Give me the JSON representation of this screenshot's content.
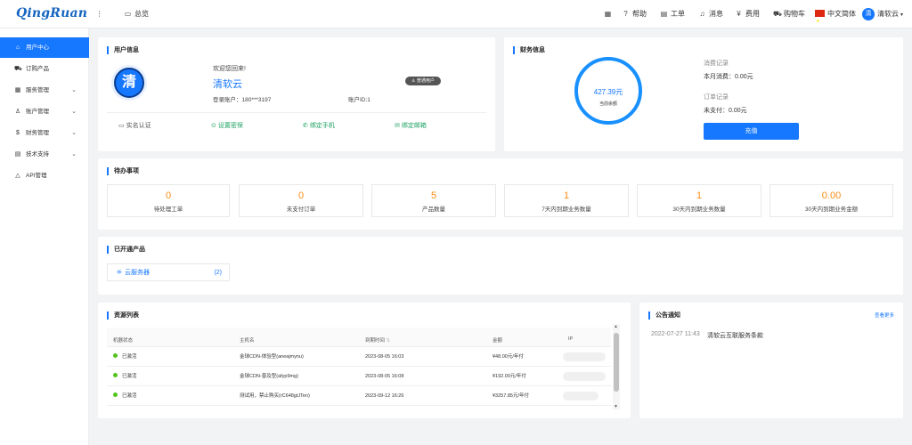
{
  "topbar": {
    "logo": "QingRuan",
    "overview": "总览",
    "help": "帮助",
    "ticket": "工单",
    "message": "消息",
    "billing": "费用",
    "cart": "购物车",
    "language": "中文简体",
    "user": "清软云",
    "user_avatar": "清"
  },
  "sidebar": {
    "items": [
      {
        "label": "用户中心",
        "icon": "home-icon"
      },
      {
        "label": "订购产品",
        "icon": "cart-icon"
      },
      {
        "label": "服务管理",
        "icon": "grid-icon"
      },
      {
        "label": "账户管理",
        "icon": "user-icon"
      },
      {
        "label": "财务管理",
        "icon": "dollar-icon"
      },
      {
        "label": "技术支持",
        "icon": "support-icon"
      },
      {
        "label": "API管理",
        "icon": "api-icon"
      }
    ]
  },
  "user_info": {
    "title": "用户信息",
    "avatar": "清",
    "welcome": "欢迎您回来!",
    "name": "清软云",
    "badge": "普通用户",
    "login_account": "登录账户：180***3197",
    "account_id": "账户ID:1",
    "actions": [
      "实名认证",
      "设置密保",
      "绑定手机",
      "绑定邮箱"
    ]
  },
  "finance": {
    "title": "财务信息",
    "balance": "427.39元",
    "balance_label": "当前余额",
    "consume_title": "消费记录",
    "month_consume": "本月消费：0.00元",
    "order_title": "订单记录",
    "unpaid": "未支付：0.00元",
    "recharge": "充值"
  },
  "todo": {
    "title": "待办事项",
    "stats": [
      {
        "value": "0",
        "label": "待处理工单"
      },
      {
        "value": "0",
        "label": "未支付订单"
      },
      {
        "value": "5",
        "label": "产品数量"
      },
      {
        "value": "1",
        "label": "7天内到期业务数量"
      },
      {
        "value": "1",
        "label": "30天内到期业务数量"
      },
      {
        "value": "0.00",
        "label": "30天内到期业务金额"
      }
    ]
  },
  "products": {
    "title": "已开通产品",
    "item_label": "云服务器",
    "item_count": "(2)"
  },
  "resources": {
    "title": "资源列表",
    "headers": [
      "机器状态",
      "主机名",
      "到期时间",
      "金额",
      "IP"
    ],
    "rows": [
      {
        "status": "已激活",
        "host": "金球CDN-体验型(aneajmynu)",
        "expire": "2023-08-05 16:03",
        "amount": "¥48.00元/年付"
      },
      {
        "status": "已激活",
        "host": "金球CDN-普及型(afyp9mg)",
        "expire": "2023-08-05 16:08",
        "amount": "¥192.00元/年付"
      },
      {
        "status": "已激活",
        "host": "测试用，禁止购买(rC648gtJTen)",
        "expire": "2023-09-12 16:26",
        "amount": "¥3257.85元/年付"
      }
    ]
  },
  "notice": {
    "title": "公告通知",
    "more": "查看更多",
    "items": [
      {
        "date": "2022-07-27 11:43",
        "text": "清软云互联服务条款"
      }
    ]
  }
}
